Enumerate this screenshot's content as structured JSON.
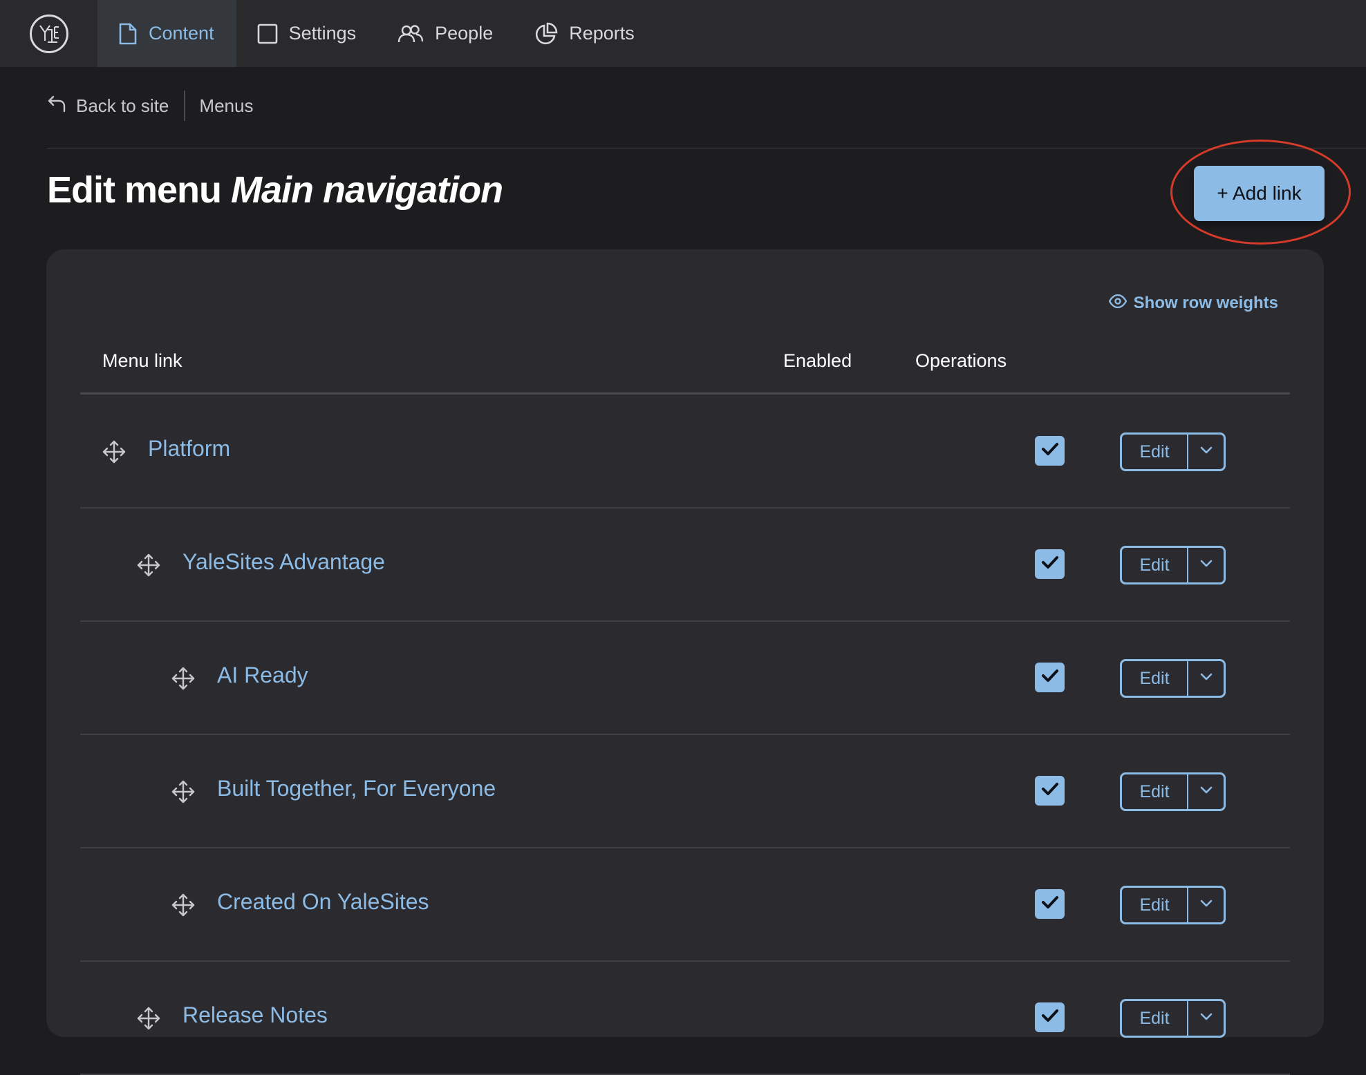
{
  "toolbar": {
    "logo_text": "YALE",
    "tabs": [
      {
        "label": "Content",
        "icon": "document-icon",
        "active": true
      },
      {
        "label": "Settings",
        "icon": "square-icon",
        "active": false
      },
      {
        "label": "People",
        "icon": "people-icon",
        "active": false
      },
      {
        "label": "Reports",
        "icon": "pie-chart-icon",
        "active": false
      }
    ]
  },
  "breadcrumb": {
    "back_label": "Back to site",
    "current": "Menus"
  },
  "page": {
    "title_prefix": "Edit menu",
    "title_menu_name": "Main navigation",
    "add_link_label": "+ Add link"
  },
  "table": {
    "show_row_weights_label": "Show row weights",
    "headers": {
      "menu_link": "Menu link",
      "enabled": "Enabled",
      "operations": "Operations"
    },
    "edit_label": "Edit",
    "rows": [
      {
        "label": "Platform",
        "depth": 0,
        "enabled": true
      },
      {
        "label": "YaleSites Advantage",
        "depth": 1,
        "enabled": true
      },
      {
        "label": "AI Ready",
        "depth": 2,
        "enabled": true
      },
      {
        "label": "Built Together, For Everyone",
        "depth": 2,
        "enabled": true
      },
      {
        "label": "Created On YaleSites",
        "depth": 2,
        "enabled": true
      },
      {
        "label": "Release Notes",
        "depth": 1,
        "enabled": true
      }
    ]
  },
  "colors": {
    "accent": "#8cbbe6",
    "annotation": "#d53a2a",
    "background": "#1d1d20",
    "toolbar": "#2a2a2d",
    "card": "#2b2b2f"
  }
}
